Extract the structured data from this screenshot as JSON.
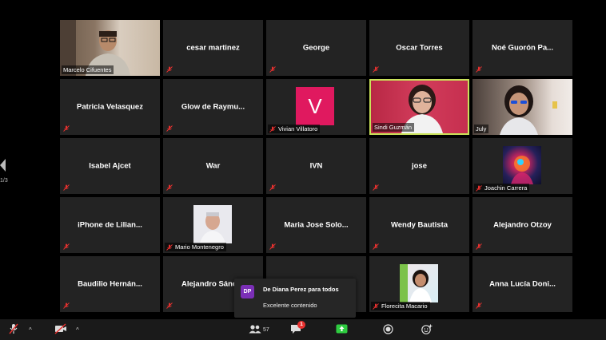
{
  "page_indicator": "1/3",
  "tiles": [
    {
      "name": "Marcelo Cifuentes",
      "kind": "video"
    },
    {
      "name": "cesar martinez",
      "kind": "name"
    },
    {
      "name": "George",
      "kind": "name"
    },
    {
      "name": "Oscar Torres",
      "kind": "name"
    },
    {
      "name": "Noé Guorón Pa...",
      "kind": "name"
    },
    {
      "name": "Patricia Velasquez",
      "kind": "name"
    },
    {
      "name": "Glow de Raymu...",
      "kind": "name"
    },
    {
      "name": "Vivian Villatoro",
      "kind": "avatar",
      "avatar_letter": "V"
    },
    {
      "name": "Sindi Guzmán",
      "kind": "video",
      "active_speaker": true
    },
    {
      "name": "July",
      "kind": "video"
    },
    {
      "name": "Isabel Ajcet",
      "kind": "name"
    },
    {
      "name": "War",
      "kind": "name"
    },
    {
      "name": "IVN",
      "kind": "name"
    },
    {
      "name": "jose",
      "kind": "name"
    },
    {
      "name": "Joachin Carrera",
      "kind": "picture"
    },
    {
      "name": "iPhone de Lilian...",
      "kind": "name"
    },
    {
      "name": "Mario Montenegro",
      "kind": "picture"
    },
    {
      "name": "Maria Jose Solo...",
      "kind": "name"
    },
    {
      "name": "Wendy Bautista",
      "kind": "name"
    },
    {
      "name": "Alejandro Otzoy",
      "kind": "name"
    },
    {
      "name": "Baudilio Hernán...",
      "kind": "name"
    },
    {
      "name": "Alejandro Sánch",
      "kind": "name"
    },
    {
      "name": "",
      "kind": "hidden"
    },
    {
      "name": "Florecita Macario",
      "kind": "picture"
    },
    {
      "name": "Anna Lucía Doni...",
      "kind": "name"
    }
  ],
  "toolbar": {
    "participants_count": "57",
    "chat_badge": "1"
  },
  "toast": {
    "avatar_initials": "DP",
    "from": "De Diana Perez para todos",
    "message": "Excelente contenido"
  },
  "colors": {
    "active_speaker_border": "#c9e25a",
    "muted_icon": "#e8312f",
    "avatar_v": "#e0195f",
    "share_button": "#2ecc40",
    "toast_avatar": "#7b2fb7"
  }
}
